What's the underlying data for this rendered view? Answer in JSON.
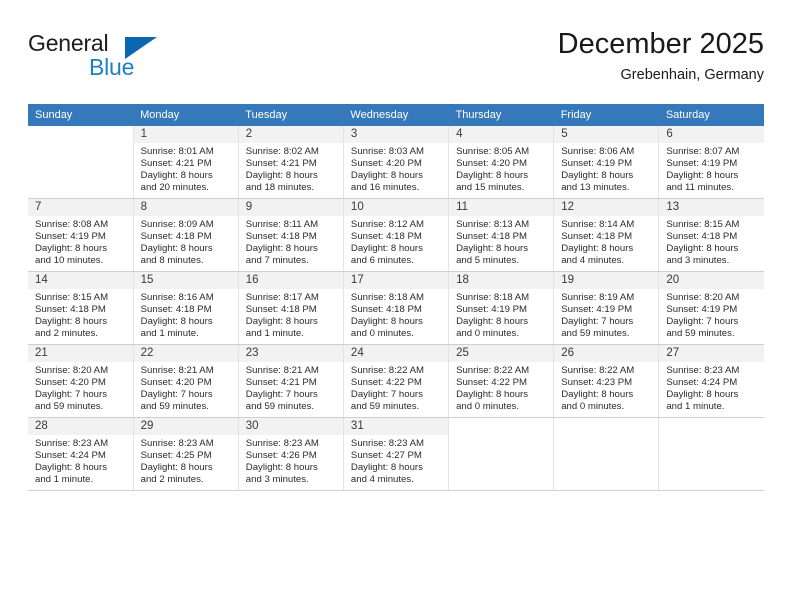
{
  "brand": {
    "word_one": "General",
    "word_two": "Blue",
    "triangle_icon": "triangle-icon"
  },
  "header": {
    "month_title": "December 2025",
    "location": "Grebenhain, Germany"
  },
  "theme": {
    "header_blue": "#3579bb",
    "brand_blue": "#1f7fc4",
    "triangle_blue": "#0b67b2",
    "daynum_bg": "#f2f2f2"
  },
  "calendar": {
    "weekday_headers": [
      "Sunday",
      "Monday",
      "Tuesday",
      "Wednesday",
      "Thursday",
      "Friday",
      "Saturday"
    ],
    "weeks": [
      [
        {
          "day": "",
          "lines": []
        },
        {
          "day": "1",
          "lines": [
            "Sunrise: 8:01 AM",
            "Sunset: 4:21 PM",
            "Daylight: 8 hours",
            "and 20 minutes."
          ]
        },
        {
          "day": "2",
          "lines": [
            "Sunrise: 8:02 AM",
            "Sunset: 4:21 PM",
            "Daylight: 8 hours",
            "and 18 minutes."
          ]
        },
        {
          "day": "3",
          "lines": [
            "Sunrise: 8:03 AM",
            "Sunset: 4:20 PM",
            "Daylight: 8 hours",
            "and 16 minutes."
          ]
        },
        {
          "day": "4",
          "lines": [
            "Sunrise: 8:05 AM",
            "Sunset: 4:20 PM",
            "Daylight: 8 hours",
            "and 15 minutes."
          ]
        },
        {
          "day": "5",
          "lines": [
            "Sunrise: 8:06 AM",
            "Sunset: 4:19 PM",
            "Daylight: 8 hours",
            "and 13 minutes."
          ]
        },
        {
          "day": "6",
          "lines": [
            "Sunrise: 8:07 AM",
            "Sunset: 4:19 PM",
            "Daylight: 8 hours",
            "and 11 minutes."
          ]
        }
      ],
      [
        {
          "day": "7",
          "lines": [
            "Sunrise: 8:08 AM",
            "Sunset: 4:19 PM",
            "Daylight: 8 hours",
            "and 10 minutes."
          ]
        },
        {
          "day": "8",
          "lines": [
            "Sunrise: 8:09 AM",
            "Sunset: 4:18 PM",
            "Daylight: 8 hours",
            "and 8 minutes."
          ]
        },
        {
          "day": "9",
          "lines": [
            "Sunrise: 8:11 AM",
            "Sunset: 4:18 PM",
            "Daylight: 8 hours",
            "and 7 minutes."
          ]
        },
        {
          "day": "10",
          "lines": [
            "Sunrise: 8:12 AM",
            "Sunset: 4:18 PM",
            "Daylight: 8 hours",
            "and 6 minutes."
          ]
        },
        {
          "day": "11",
          "lines": [
            "Sunrise: 8:13 AM",
            "Sunset: 4:18 PM",
            "Daylight: 8 hours",
            "and 5 minutes."
          ]
        },
        {
          "day": "12",
          "lines": [
            "Sunrise: 8:14 AM",
            "Sunset: 4:18 PM",
            "Daylight: 8 hours",
            "and 4 minutes."
          ]
        },
        {
          "day": "13",
          "lines": [
            "Sunrise: 8:15 AM",
            "Sunset: 4:18 PM",
            "Daylight: 8 hours",
            "and 3 minutes."
          ]
        }
      ],
      [
        {
          "day": "14",
          "lines": [
            "Sunrise: 8:15 AM",
            "Sunset: 4:18 PM",
            "Daylight: 8 hours",
            "and 2 minutes."
          ]
        },
        {
          "day": "15",
          "lines": [
            "Sunrise: 8:16 AM",
            "Sunset: 4:18 PM",
            "Daylight: 8 hours",
            "and 1 minute."
          ]
        },
        {
          "day": "16",
          "lines": [
            "Sunrise: 8:17 AM",
            "Sunset: 4:18 PM",
            "Daylight: 8 hours",
            "and 1 minute."
          ]
        },
        {
          "day": "17",
          "lines": [
            "Sunrise: 8:18 AM",
            "Sunset: 4:18 PM",
            "Daylight: 8 hours",
            "and 0 minutes."
          ]
        },
        {
          "day": "18",
          "lines": [
            "Sunrise: 8:18 AM",
            "Sunset: 4:19 PM",
            "Daylight: 8 hours",
            "and 0 minutes."
          ]
        },
        {
          "day": "19",
          "lines": [
            "Sunrise: 8:19 AM",
            "Sunset: 4:19 PM",
            "Daylight: 7 hours",
            "and 59 minutes."
          ]
        },
        {
          "day": "20",
          "lines": [
            "Sunrise: 8:20 AM",
            "Sunset: 4:19 PM",
            "Daylight: 7 hours",
            "and 59 minutes."
          ]
        }
      ],
      [
        {
          "day": "21",
          "lines": [
            "Sunrise: 8:20 AM",
            "Sunset: 4:20 PM",
            "Daylight: 7 hours",
            "and 59 minutes."
          ]
        },
        {
          "day": "22",
          "lines": [
            "Sunrise: 8:21 AM",
            "Sunset: 4:20 PM",
            "Daylight: 7 hours",
            "and 59 minutes."
          ]
        },
        {
          "day": "23",
          "lines": [
            "Sunrise: 8:21 AM",
            "Sunset: 4:21 PM",
            "Daylight: 7 hours",
            "and 59 minutes."
          ]
        },
        {
          "day": "24",
          "lines": [
            "Sunrise: 8:22 AM",
            "Sunset: 4:22 PM",
            "Daylight: 7 hours",
            "and 59 minutes."
          ]
        },
        {
          "day": "25",
          "lines": [
            "Sunrise: 8:22 AM",
            "Sunset: 4:22 PM",
            "Daylight: 8 hours",
            "and 0 minutes."
          ]
        },
        {
          "day": "26",
          "lines": [
            "Sunrise: 8:22 AM",
            "Sunset: 4:23 PM",
            "Daylight: 8 hours",
            "and 0 minutes."
          ]
        },
        {
          "day": "27",
          "lines": [
            "Sunrise: 8:23 AM",
            "Sunset: 4:24 PM",
            "Daylight: 8 hours",
            "and 1 minute."
          ]
        }
      ],
      [
        {
          "day": "28",
          "lines": [
            "Sunrise: 8:23 AM",
            "Sunset: 4:24 PM",
            "Daylight: 8 hours",
            "and 1 minute."
          ]
        },
        {
          "day": "29",
          "lines": [
            "Sunrise: 8:23 AM",
            "Sunset: 4:25 PM",
            "Daylight: 8 hours",
            "and 2 minutes."
          ]
        },
        {
          "day": "30",
          "lines": [
            "Sunrise: 8:23 AM",
            "Sunset: 4:26 PM",
            "Daylight: 8 hours",
            "and 3 minutes."
          ]
        },
        {
          "day": "31",
          "lines": [
            "Sunrise: 8:23 AM",
            "Sunset: 4:27 PM",
            "Daylight: 8 hours",
            "and 4 minutes."
          ]
        },
        {
          "day": "",
          "lines": []
        },
        {
          "day": "",
          "lines": []
        },
        {
          "day": "",
          "lines": []
        }
      ]
    ]
  }
}
